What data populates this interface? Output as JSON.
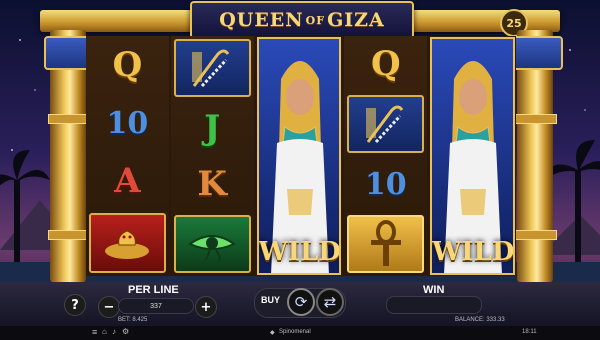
{
  "game": {
    "title_main": "QUEEN",
    "title_of": "OF",
    "title_end": "GIZA",
    "lines_count": "25"
  },
  "reels": [
    [
      "Q",
      "10",
      "A",
      "cobra"
    ],
    [
      "pharaoh-symbol",
      "J",
      "K",
      "eye-of-horus"
    ],
    [
      "WILD"
    ],
    [
      "Q",
      "pharaoh-symbol",
      "10",
      "ankh"
    ],
    [
      "WILD"
    ]
  ],
  "wild_label": "WILD",
  "controls": {
    "help_label": "?",
    "minus_label": "−",
    "plus_label": "+",
    "per_line_label": "PER LINE",
    "per_line_value": "337",
    "buy_label": "BUY",
    "win_label": "WIN",
    "win_value": ""
  },
  "status": {
    "bet_text": "BET: 8.425",
    "balance_text": "BALANCE: 333.33",
    "brand_text": "Spinomenal",
    "time_text": "18:11"
  },
  "colors": {
    "gold": "#e8c15a",
    "reel_blue": "#1e3a9a",
    "night_sky": "#0b1030"
  }
}
